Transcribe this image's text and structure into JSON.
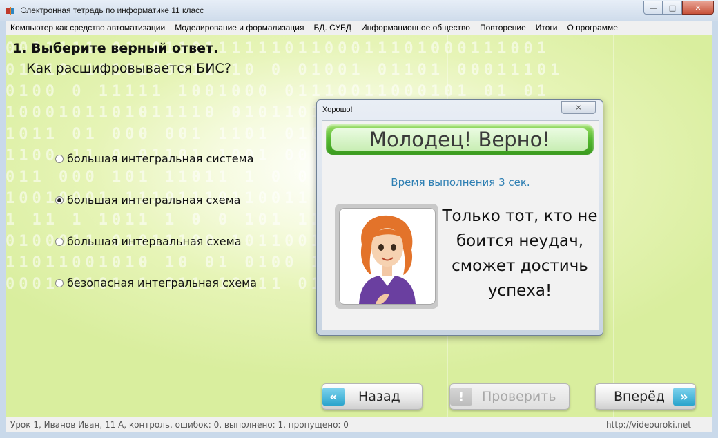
{
  "window": {
    "title": "Электронная тетрадь по информатике 11 класс"
  },
  "menu": [
    "Компьютер как средство автоматизации",
    "Моделирование и формализация",
    "БД. СУБД",
    "Информационное общество",
    "Повторение",
    "Итоги",
    "О программе"
  ],
  "question": {
    "title": "1. Выберите верный ответ.",
    "text": "Как расшифровывается БИС?",
    "options": [
      {
        "label": "большая интегральная система",
        "selected": false
      },
      {
        "label": "большая интегральная схема",
        "selected": true
      },
      {
        "label": "большая интервальная схема",
        "selected": false
      },
      {
        "label": "безопасная интегральная схема",
        "selected": false
      }
    ]
  },
  "background_digits": [
    "0011111 01 011011111101100011101000111001",
    "01110 1010100011 10 0 01001 01101 00011101",
    "0100 0 11111 1001000 01110011000101 01 01",
    "1000101101011110 01011010 01 10 010 011",
    "1011 01 000 001 1101 0100 011 000 01 110",
    "1100 11 0 01101 1001 00 1010 0110 0001 00",
    "011 000 101 11011 1 0 0 0111 01101 10 0001",
    "10010001 11101110110011 01 11011011 1011",
    "1 11 1 1011 1 0 0 101 110 010111011101000",
    "0100011 01011100 1011001101101 110101010",
    "11011001010 10 01 0100 1100 0011 0011 01",
    "0001 0101 1 011 10111 011010 1101 1110 01"
  ],
  "buttons": {
    "back": "Назад",
    "check": "Проверить",
    "forward": "Вперёд"
  },
  "status": {
    "left": "Урок 1, Иванов Иван, 11 А, контроль, ошибок: 0, выполнено: 1, пропущено: 0",
    "right": "http://videouroki.net"
  },
  "dialog": {
    "title": "Хорошо!",
    "close_glyph": "⨯",
    "banner": "Молодец! Верно!",
    "time": "Время выполнения 3 сек.",
    "quote_lines": [
      "Только тот, кто не",
      "боится неудач,",
      "сможет достичь",
      "успеха!"
    ]
  },
  "icons": {
    "minimize": "minimize-icon",
    "maximize": "maximize-icon",
    "close": "close-icon",
    "back": "chevron-left-double-icon",
    "forward": "chevron-right-double-icon",
    "check": "exclamation-icon"
  },
  "colors": {
    "accent_green": "#53b82f",
    "time_text": "#2e7fb3",
    "chevron_blue": "#2aa4cc"
  }
}
